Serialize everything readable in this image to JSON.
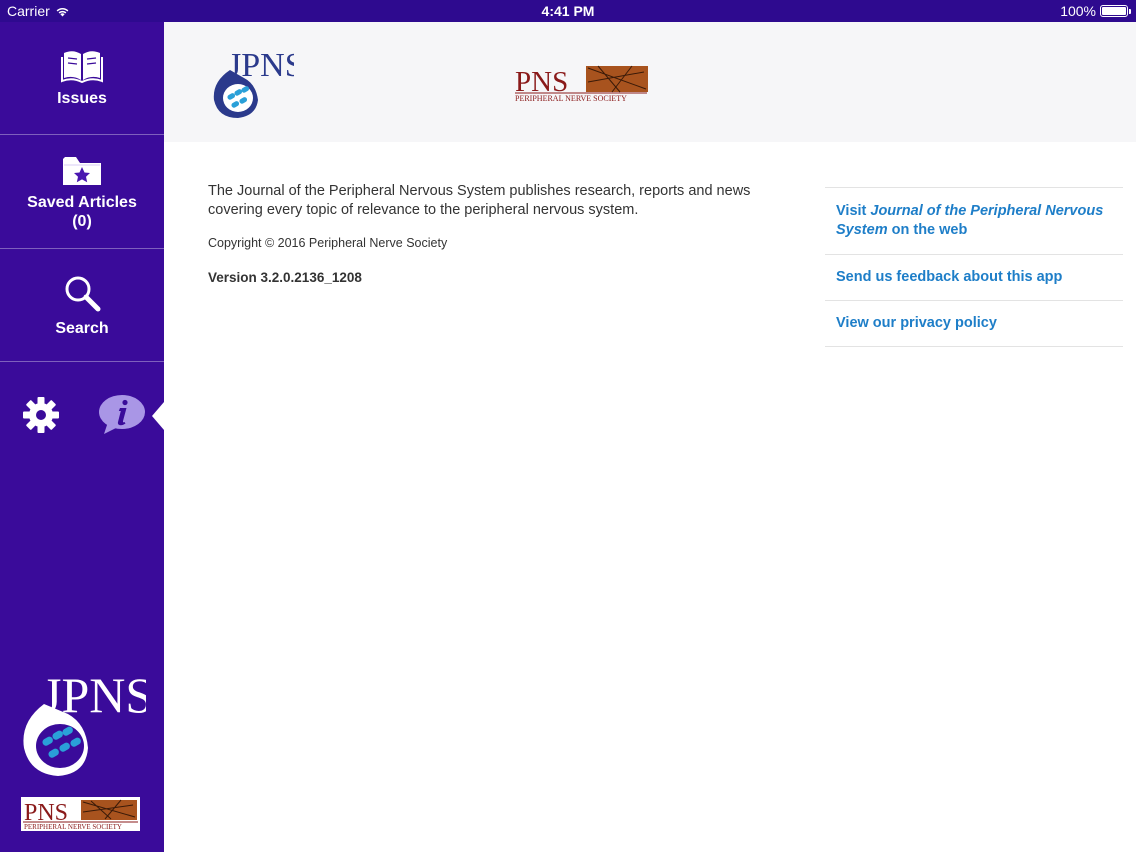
{
  "status_bar": {
    "carrier": "Carrier",
    "time": "4:41 PM",
    "battery": "100%"
  },
  "sidebar": {
    "items": [
      {
        "label": "Issues",
        "icon": "open-book-icon"
      },
      {
        "label": "Saved Articles",
        "count": "(0)",
        "icon": "star-folder-icon"
      },
      {
        "label": "Search",
        "icon": "magnifier-icon"
      }
    ],
    "utility": [
      {
        "icon": "gear-icon"
      },
      {
        "icon": "info-bubble-icon",
        "selected": true
      }
    ],
    "logos": [
      "JPNS",
      "PNS"
    ]
  },
  "header": {
    "logo_left": "JPNS",
    "logo_right_title": "PNS",
    "logo_right_subtitle": "PERIPHERAL NERVE SOCIETY"
  },
  "about": {
    "description": "The Journal of the Peripheral Nervous System publishes research, reports and news covering every topic of relevance to the peripheral nervous system.",
    "copyright": "Copyright © 2016 Peripheral Nerve Society",
    "version": "Version 3.2.0.2136_1208"
  },
  "links": {
    "visit_prefix": "Visit ",
    "visit_journal": "Journal of the Peripheral Nervous System",
    "visit_suffix": " on the web",
    "feedback": "Send us feedback about this app",
    "privacy": "View our privacy policy"
  },
  "colors": {
    "sidebar_bg": "#3a0b9a",
    "statusbar_bg": "#2e0a8f",
    "link": "#1e7ec8",
    "header_band": "#f6f6f8",
    "accent_lilac": "#a996e6"
  }
}
